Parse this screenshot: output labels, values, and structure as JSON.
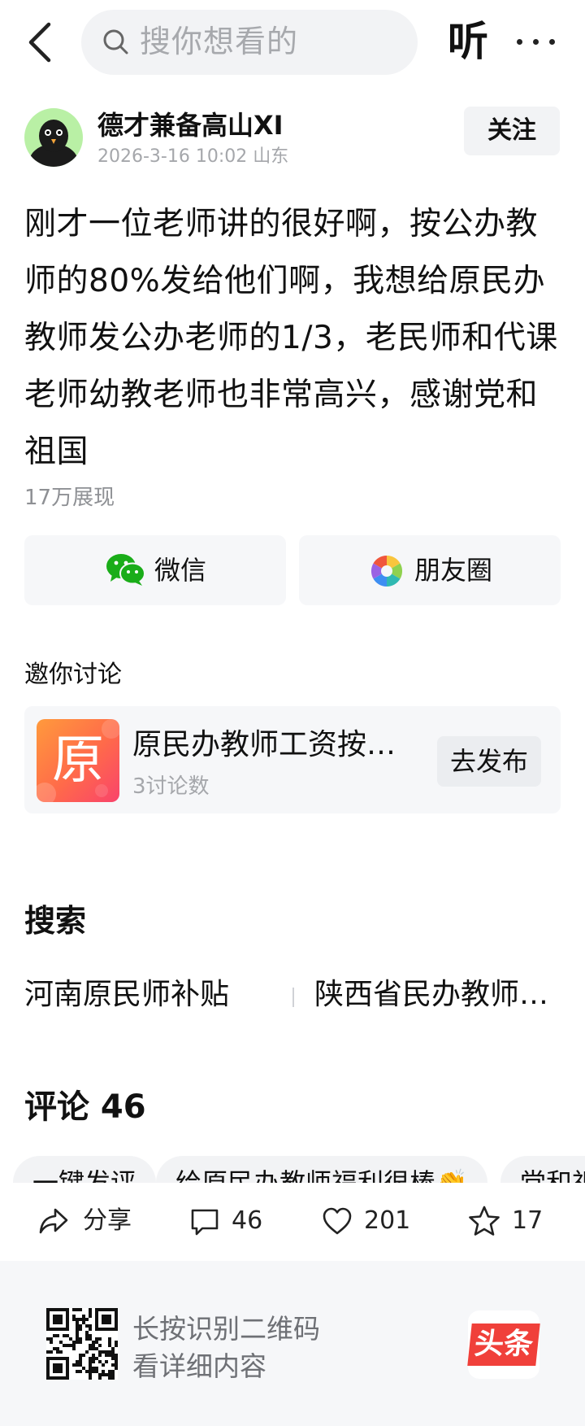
{
  "header": {
    "search_placeholder": "搜你想看的",
    "listen_label": "听"
  },
  "author": {
    "name": "德才兼备高山XI",
    "meta": "2026-3-16 10:02 山东",
    "follow_label": "关注"
  },
  "post": {
    "body": "刚才一位老师讲的很好啊，按公办教师的80%发给他们啊，我想给原民办教师发公办老师的1/3，老民师和代课老师幼教老师也非常高兴，感谢党和祖国",
    "views": "17万展现"
  },
  "share": {
    "wechat_label": "微信",
    "moments_label": "朋友圈"
  },
  "invite": {
    "title": "邀你讨论",
    "topic_thumb_char": "原",
    "topic_title": "原民办教师工资按…",
    "topic_count": "3讨论数",
    "publish_label": "去发布"
  },
  "search_section": {
    "title": "搜索",
    "suggestions": [
      "河南原民师补贴",
      "陕西省民办教师…"
    ]
  },
  "comments": {
    "title": "评论 46",
    "chips": [
      "一键发评",
      "给原民办教师福利很棒👏",
      "党和祖"
    ]
  },
  "actions": {
    "share_label": "分享",
    "comment_count": "46",
    "like_count": "201",
    "favorite_count": "17"
  },
  "footer": {
    "line1": "长按识别二维码",
    "line2": "看详细内容",
    "logo_text": "头条"
  },
  "colors": {
    "wechat_green": "#1aad19",
    "logo_red": "#f0403a",
    "muted_text": "#a5a7ab"
  }
}
